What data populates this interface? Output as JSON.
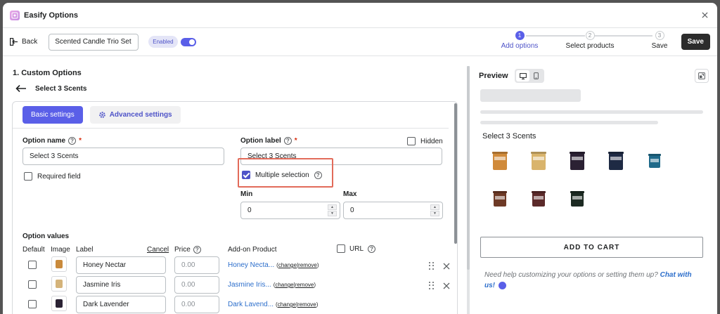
{
  "app": {
    "title": "Easify Options"
  },
  "toolbar": {
    "back_label": "Back",
    "option_set_name": "Scented Candle Trio Set",
    "status_badge": "Enabled",
    "save_label": "Save"
  },
  "stepper": {
    "steps": [
      {
        "number": "1",
        "label": "Add options",
        "active": true
      },
      {
        "number": "2",
        "label": "Select products",
        "active": false
      },
      {
        "number": "3",
        "label": "Save",
        "active": false
      }
    ]
  },
  "editor": {
    "section_title": "1. Custom Options",
    "option_title": "Select 3 Scents",
    "tabs": {
      "basic": "Basic settings",
      "advanced": "Advanced settings"
    },
    "option_name": {
      "label": "Option name",
      "required_mark": "*",
      "value": "Select 3 Scents"
    },
    "option_label": {
      "label": "Option label",
      "required_mark": "*",
      "value": "Select 3 Scents"
    },
    "hidden_label": "Hidden",
    "required_field_label": "Required field",
    "multiple_selection": {
      "label": "Multiple selection",
      "checked": true
    },
    "min": {
      "label": "Min",
      "value": "0"
    },
    "max": {
      "label": "Max",
      "value": "0"
    },
    "option_values": {
      "title": "Option values",
      "headers": {
        "default": "Default",
        "image": "Image",
        "label": "Label",
        "cancel": "Cancel",
        "price": "Price",
        "addon": "Add-on Product",
        "url": "URL"
      },
      "rows": [
        {
          "label": "Honey Nectar",
          "price_placeholder": "0.00",
          "addon_product": "Honey Necta...",
          "change": "change",
          "remove": "remove",
          "jar_color": "#c98a3c"
        },
        {
          "label": "Jasmine Iris",
          "price_placeholder": "0.00",
          "addon_product": "Jasmine Iris...",
          "change": "change",
          "remove": "remove",
          "jar_color": "#d4b37a"
        },
        {
          "label": "Dark Lavender",
          "price_placeholder": "0.00",
          "addon_product": "Dark Lavend...",
          "change": "change",
          "remove": "remove",
          "jar_color": "#2a2233"
        }
      ]
    }
  },
  "preview": {
    "title": "Preview",
    "option_label": "Select 3 Scents",
    "items": [
      {
        "color": "#d08a3a"
      },
      {
        "color": "#d9b46c"
      },
      {
        "color": "#2b2133"
      },
      {
        "color": "#1e2a44"
      },
      {
        "color": "#1f6a8a"
      },
      {
        "color": "#6e3a26"
      },
      {
        "color": "#5b2a2a"
      },
      {
        "color": "#1c2a22"
      }
    ],
    "add_to_cart": "ADD TO CART",
    "help_text": "Need help customizing your options or setting them up?",
    "help_link": "Chat with us!"
  },
  "colors": {
    "accent": "#5a5fe8",
    "highlight": "#e26b5a",
    "link": "#2c6ecb"
  }
}
